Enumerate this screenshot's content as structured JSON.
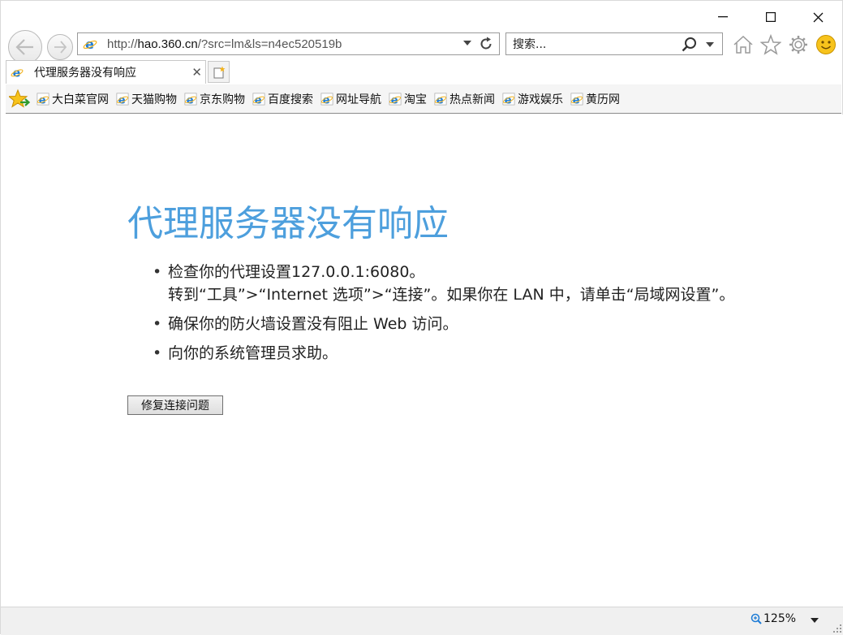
{
  "window": {
    "minimize_label": "—",
    "maximize_label": "☐",
    "close_label": "✕"
  },
  "address_bar": {
    "url_prefix": "http://",
    "url_host": "hao.360.cn",
    "url_rest": "/?src=lm&ls=n4ec520519b"
  },
  "search": {
    "placeholder": "搜索..."
  },
  "tab": {
    "title": "代理服务器没有响应",
    "close_label": "✕"
  },
  "favorites": [
    {
      "label": "大白菜官网"
    },
    {
      "label": "天猫购物"
    },
    {
      "label": "京东购物"
    },
    {
      "label": "百度搜索"
    },
    {
      "label": "网址导航"
    },
    {
      "label": "淘宝"
    },
    {
      "label": "热点新闻"
    },
    {
      "label": "游戏娱乐"
    },
    {
      "label": "黄历网"
    }
  ],
  "error": {
    "title": "代理服务器没有响应",
    "items": [
      "检查你的代理设置127.0.0.1:6080。",
      "转到“工具”>“Internet 选项”>“连接”。如果你在 LAN 中，请单击“局域网设置”。",
      "确保你的防火墙设置没有阻止 Web 访问。",
      "向你的系统管理员求助。"
    ],
    "fix_button": "修复连接问题"
  },
  "status": {
    "zoom": "125%"
  },
  "colors": {
    "title_blue": "#2e8fd8",
    "ie_blue": "#1e7cd6",
    "favorites_bg": "#f5f5f5"
  }
}
